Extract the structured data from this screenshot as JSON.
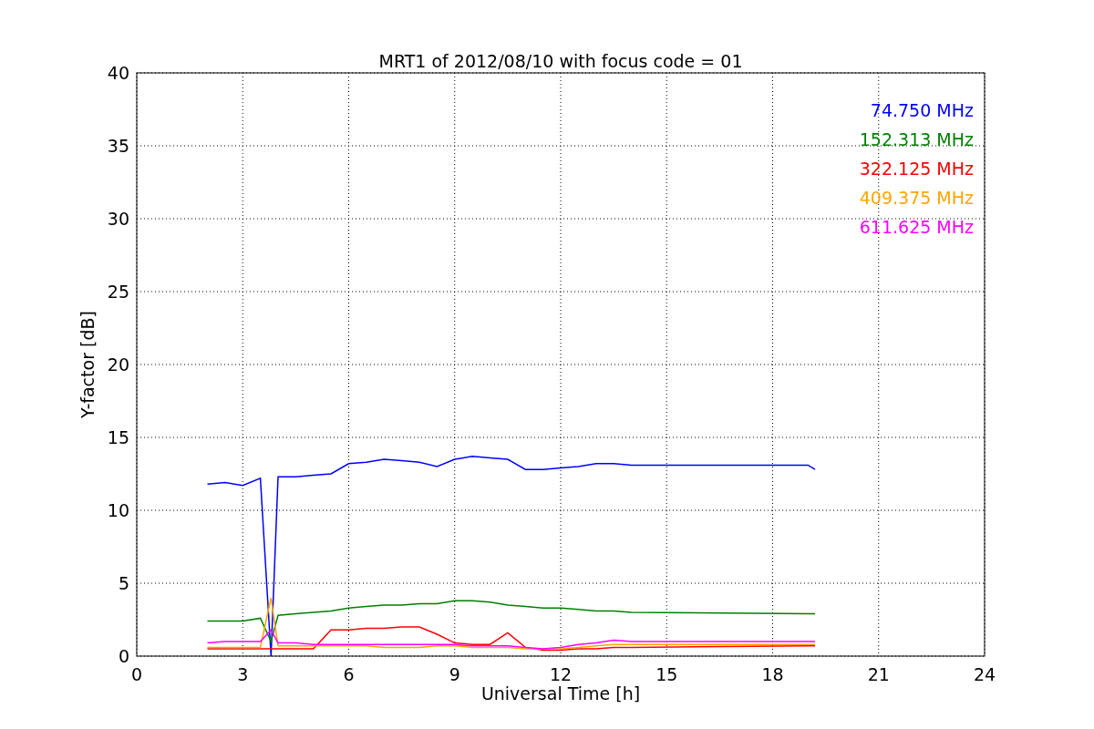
{
  "chart_data": {
    "type": "line",
    "title": "MRT1 of 2012/08/10 with focus code = 01",
    "xlabel": "Universal Time [h]",
    "ylabel": "Y-factor [dB]",
    "x": [
      2,
      2.5,
      3,
      3.5,
      3.8,
      4,
      4.5,
      5,
      5.5,
      6,
      6.5,
      7,
      7.5,
      8,
      8.5,
      9,
      9.5,
      10,
      10.5,
      11,
      11.5,
      12,
      12.5,
      13,
      13.5,
      14,
      19,
      19.2
    ],
    "series": [
      {
        "name": "74.750 MHz",
        "color": "#0000ff",
        "values": [
          11.8,
          11.9,
          11.7,
          12.2,
          0,
          12.3,
          12.3,
          12.4,
          12.5,
          13.2,
          13.3,
          13.5,
          13.4,
          13.3,
          13.0,
          13.5,
          13.7,
          13.6,
          13.5,
          12.8,
          12.8,
          12.9,
          13.0,
          13.2,
          13.2,
          13.1,
          13.1,
          12.8
        ]
      },
      {
        "name": "152.313 MHz",
        "color": "#008000",
        "values": [
          2.4,
          2.4,
          2.4,
          2.6,
          1.0,
          2.8,
          2.9,
          3.0,
          3.1,
          3.3,
          3.4,
          3.5,
          3.5,
          3.6,
          3.6,
          3.8,
          3.8,
          3.7,
          3.5,
          3.4,
          3.3,
          3.3,
          3.2,
          3.1,
          3.1,
          3.0,
          2.9,
          2.9
        ]
      },
      {
        "name": "322.125 MHz",
        "color": "#ff0000",
        "values": [
          0.5,
          0.5,
          0.5,
          0.5,
          0.5,
          0.5,
          0.5,
          0.5,
          1.8,
          1.8,
          1.9,
          1.9,
          2.0,
          2.0,
          1.5,
          0.9,
          0.8,
          0.8,
          1.6,
          0.6,
          0.4,
          0.4,
          0.5,
          0.5,
          0.6,
          0.6,
          0.7,
          0.7
        ]
      },
      {
        "name": "409.375 MHz",
        "color": "#ffa500",
        "values": [
          0.6,
          0.6,
          0.6,
          0.6,
          4.0,
          0.7,
          0.7,
          0.7,
          0.7,
          0.7,
          0.7,
          0.6,
          0.6,
          0.6,
          0.7,
          0.7,
          0.6,
          0.6,
          0.6,
          0.5,
          0.5,
          0.5,
          0.6,
          0.7,
          0.8,
          0.8,
          0.8,
          0.8
        ]
      },
      {
        "name": "611.625 MHz",
        "color": "#ff00ff",
        "values": [
          0.9,
          1.0,
          1.0,
          1.0,
          1.8,
          0.9,
          0.9,
          0.8,
          0.8,
          0.8,
          0.8,
          0.8,
          0.8,
          0.8,
          0.8,
          0.8,
          0.7,
          0.7,
          0.7,
          0.6,
          0.5,
          0.6,
          0.8,
          0.9,
          1.1,
          1.0,
          1.0,
          1.0
        ]
      }
    ],
    "grid": true,
    "xlim": [
      0,
      24
    ],
    "ylim": [
      0,
      40
    ],
    "xticks": [
      0,
      3,
      6,
      9,
      12,
      15,
      18,
      21,
      24
    ],
    "yticks": [
      0,
      5,
      10,
      15,
      20,
      25,
      30,
      35,
      40
    ]
  }
}
